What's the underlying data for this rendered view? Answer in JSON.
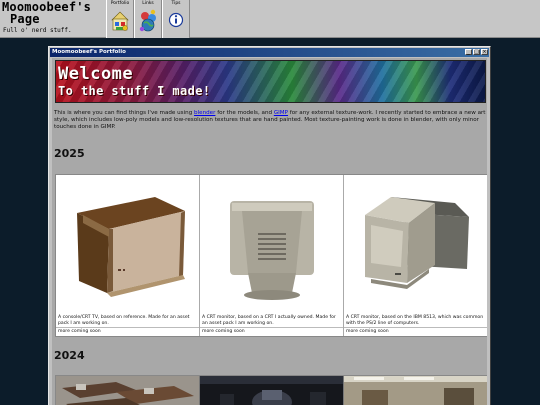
{
  "site": {
    "title_line1": "Moomoobeef's",
    "title_line2": "Page",
    "subtitle": "Full o' nerd stuff."
  },
  "nav": [
    {
      "label": "Portfolio",
      "icon": "portfolio-icon"
    },
    {
      "label": "Links",
      "icon": "links-icon"
    },
    {
      "label": "Tips",
      "icon": "info-icon"
    }
  ],
  "window": {
    "title": "Moomoobeef's Portfolio",
    "buttons": {
      "minimize": "_",
      "maximize": "□",
      "close": "×"
    }
  },
  "banner": {
    "line1": "Welcome",
    "line2": "To the stuff I made!"
  },
  "intro": {
    "part1": "This is where you can find things I've made using ",
    "link1": "blender",
    "part2": " for the models, and ",
    "link2": "GIMP",
    "part3": " for any external texture-work. I recently started to embrace a new art style, which includes low-poly models and low-resolution textures that are hand painted. Most texture-painting work is done in blender, with only minor touches done in GIMP."
  },
  "sections": [
    {
      "year": "2025",
      "items": [
        {
          "icon": "crt-tv-model",
          "description": "A console/CRT TV, based on reference. Made for an asset pack I am working on.",
          "more": "more coming soon"
        },
        {
          "icon": "crt-monitor-back-model",
          "description": "A CRT monitor, based on a CRT I actually owned. Made for an asset pack I am working on.",
          "more": "more coming soon"
        },
        {
          "icon": "crt-monitor-ibm-model",
          "description": "A CRT monitor, based on the IBM 8513, which was common with the PS/2 line of computers.",
          "more": "more coming soon"
        }
      ]
    },
    {
      "year": "2024",
      "items": [
        {
          "icon": "desks-render"
        },
        {
          "icon": "dark-room-render"
        },
        {
          "icon": "office-render"
        }
      ]
    }
  ],
  "colors": {
    "page_bg": "#0c1c2a",
    "window_bg": "#c0c0c0",
    "titlebar": "#0a246a",
    "content_bg": "#a8a8a8",
    "link": "#0000ee"
  }
}
